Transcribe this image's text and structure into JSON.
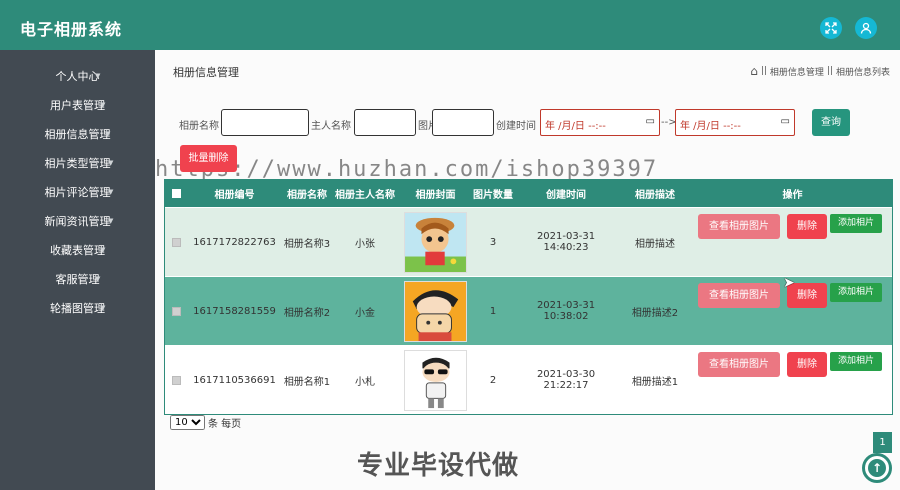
{
  "app": {
    "title": "电子相册系统"
  },
  "topbar": {
    "fullscreen_icon": "expand-icon",
    "user_icon": "user-icon"
  },
  "sidebar": {
    "items": [
      {
        "label": "个人中心",
        "has_caret": true
      },
      {
        "label": "用户表管理",
        "has_caret": true
      },
      {
        "label": "相册信息管理",
        "has_caret": true
      },
      {
        "label": "相片类型管理",
        "has_caret": true
      },
      {
        "label": "相片评论管理",
        "has_caret": true
      },
      {
        "label": "新闻资讯管理",
        "has_caret": true
      },
      {
        "label": "收藏表管理",
        "has_caret": true
      },
      {
        "label": "客服管理",
        "has_caret": true
      },
      {
        "label": "轮播图管理",
        "has_caret": true
      }
    ]
  },
  "page": {
    "title": "相册信息管理"
  },
  "breadcrumb": {
    "home_icon": "home-icon",
    "sep": "||",
    "item1": "相册信息管理",
    "item2": "相册信息列表"
  },
  "search": {
    "label_name": "相册名称",
    "label_owner": "主人名称",
    "label_count": "图片数量",
    "label_time": "创建时间",
    "date_placeholder": "年 /月/日 --:--",
    "range_sep": "-->",
    "search_label": "查询",
    "batch_delete_label": "批量删除"
  },
  "watermark": "https://www.huzhan.com/ishop39397",
  "table": {
    "headers": [
      "相册编号",
      "相册名称",
      "相册主人名称",
      "相册封面",
      "图片数量",
      "创建时间",
      "相册描述",
      "操作"
    ],
    "rows": [
      {
        "id": "1617172822763",
        "name": "相册名称3",
        "owner": "小张",
        "cover": "fox-girl-avatar",
        "count": "3",
        "time": "2021-03-31 14:40:23",
        "desc": "相册描述"
      },
      {
        "id": "1617158281559",
        "name": "相册名称2",
        "owner": "小金",
        "cover": "shinchan-with-pig",
        "count": "1",
        "time": "2021-03-31 10:38:02",
        "desc": "相册描述2"
      },
      {
        "id": "1617110536691",
        "name": "相册名称1",
        "owner": "小札",
        "cover": "shinchan-sunglasses",
        "count": "2",
        "time": "2021-03-30 21:22:17",
        "desc": "相册描述1"
      }
    ],
    "actions": {
      "view": "查看相册图片",
      "delete": "删除",
      "add": "添加相片"
    }
  },
  "pager": {
    "page_size": "10",
    "per_page_label": "条 每页",
    "current_page": "1"
  },
  "promo": "专业毕设代做",
  "colors": {
    "primary": "#2e8b7a",
    "sidebar": "#424a52",
    "danger": "#f0424e",
    "pink": "#eb7782",
    "success": "#27a14a"
  }
}
